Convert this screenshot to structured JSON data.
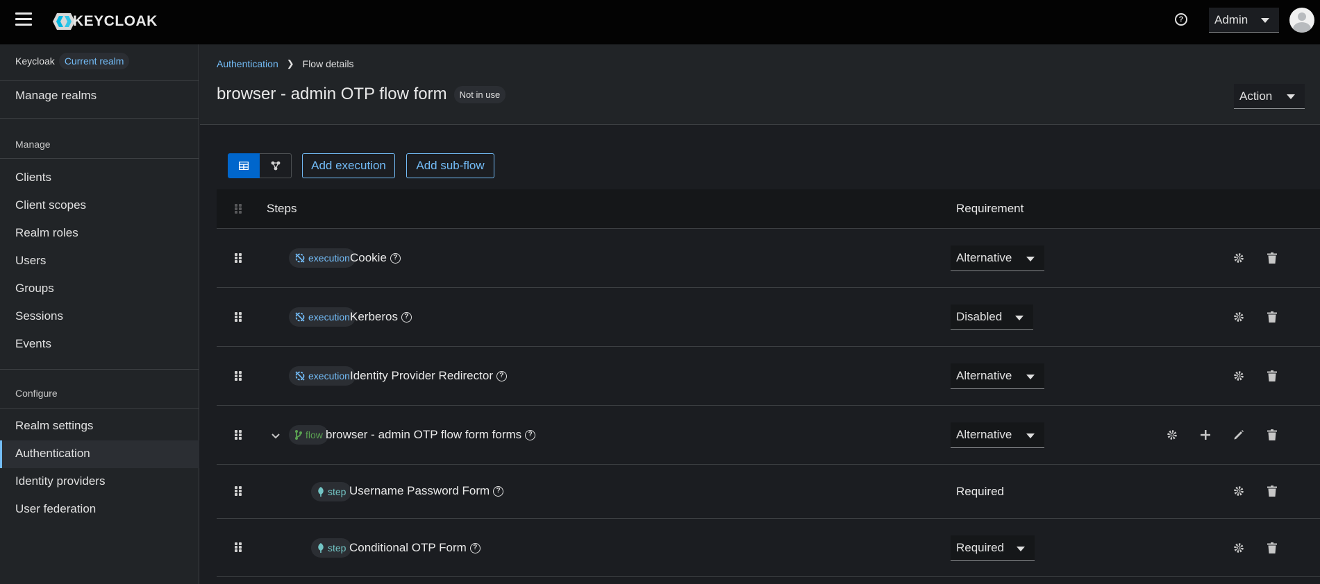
{
  "header": {
    "logo_text": "KEYCLOAK",
    "user_menu": "Admin"
  },
  "sidebar": {
    "realm_name": "Keycloak",
    "realm_badge": "Current realm",
    "manage_realms": "Manage realms",
    "manage_section": "Manage",
    "manage_items": [
      "Clients",
      "Client scopes",
      "Realm roles",
      "Users",
      "Groups",
      "Sessions",
      "Events"
    ],
    "configure_section": "Configure",
    "configure_items": [
      "Realm settings",
      "Authentication",
      "Identity providers",
      "User federation"
    ],
    "active_item": "Authentication"
  },
  "breadcrumb": {
    "parent": "Authentication",
    "current": "Flow details"
  },
  "page": {
    "title": "browser - admin OTP flow form",
    "status": "Not in use",
    "action_label": "Action"
  },
  "toolbar": {
    "add_execution": "Add execution",
    "add_subflow": "Add sub-flow"
  },
  "table": {
    "columns": {
      "steps": "Steps",
      "requirement": "Requirement"
    },
    "rows": [
      {
        "type": "execution",
        "name": "Cookie",
        "requirement": "Alternative"
      },
      {
        "type": "execution",
        "name": "Kerberos",
        "requirement": "Disabled"
      },
      {
        "type": "execution",
        "name": "Identity Provider Redirector",
        "requirement": "Alternative"
      },
      {
        "type": "flow",
        "name": "browser - admin OTP flow form forms",
        "requirement": "Alternative"
      },
      {
        "type": "step",
        "name": "Username Password Form",
        "requirement": "Required"
      },
      {
        "type": "step",
        "name": "Conditional OTP Form",
        "requirement": "Required"
      }
    ]
  },
  "colors": {
    "accent": "#73bcf7",
    "primary": "#0066cc",
    "flow": "#5ba352",
    "step": "#73c5c5"
  }
}
